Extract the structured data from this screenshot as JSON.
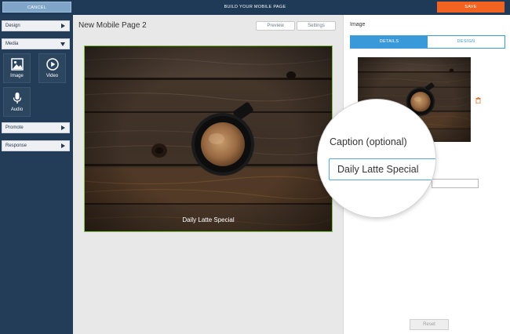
{
  "topbar": {
    "cancel_label": "CANCEL",
    "title": "BUILD YOUR MOBILE PAGE",
    "save_label": "SAVE",
    "save_color": "#f26322"
  },
  "sidebar": {
    "items": [
      {
        "label": "Design",
        "state": "collapsed"
      },
      {
        "label": "Media",
        "state": "expanded"
      },
      {
        "label": "Promote",
        "state": "collapsed"
      },
      {
        "label": "Response",
        "state": "collapsed"
      }
    ],
    "media_tiles": [
      {
        "label": "Image",
        "icon": "image-icon"
      },
      {
        "label": "Video",
        "icon": "play-icon"
      },
      {
        "label": "Audio",
        "icon": "microphone-icon"
      }
    ]
  },
  "canvas": {
    "page_title": "New Mobile Page 2",
    "preview_label": "Preview",
    "settings_label": "Settings",
    "image_caption": "Daily Latte Special"
  },
  "panel": {
    "title": "Image",
    "tabs": [
      {
        "label": "DETAILS",
        "active": true
      },
      {
        "label": "DESIGN",
        "active": false
      }
    ],
    "caption_label": "Caption (optional)",
    "caption_value": "Daily Latte Special",
    "reset_label": "Reset",
    "accent_color": "#3a9ad9"
  }
}
